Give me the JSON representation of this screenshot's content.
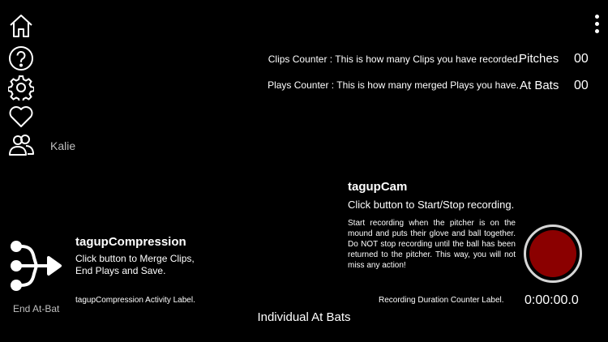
{
  "sidebar": {
    "user_name": "Kalie"
  },
  "counters": [
    {
      "description": "Clips Counter :  This is how many Clips you have recorded.",
      "name": "Pitches",
      "value": "00"
    },
    {
      "description": "Plays Counter :  This is how many merged Plays you have.",
      "name": "At Bats",
      "value": "00"
    }
  ],
  "compression": {
    "title": "tagupCompression",
    "instruction": "Click button to Merge Clips, End Plays and Save.",
    "button_label": "End At-Bat",
    "activity_label": "tagupCompression Activity Label."
  },
  "cam": {
    "title": "tagupCam",
    "instruction": "Click button to Start/Stop recording.",
    "details": "Start recording when the pitcher is on the mound and puts their glove and ball together. Do NOT stop recording until the ball has been returned to the pitcher. This way, you will not miss any action!",
    "duration_label": "Recording Duration Counter Label.",
    "duration": "0:00:00.0",
    "record_color": "#8b0000"
  },
  "footer": {
    "mode": "Individual At Bats"
  }
}
